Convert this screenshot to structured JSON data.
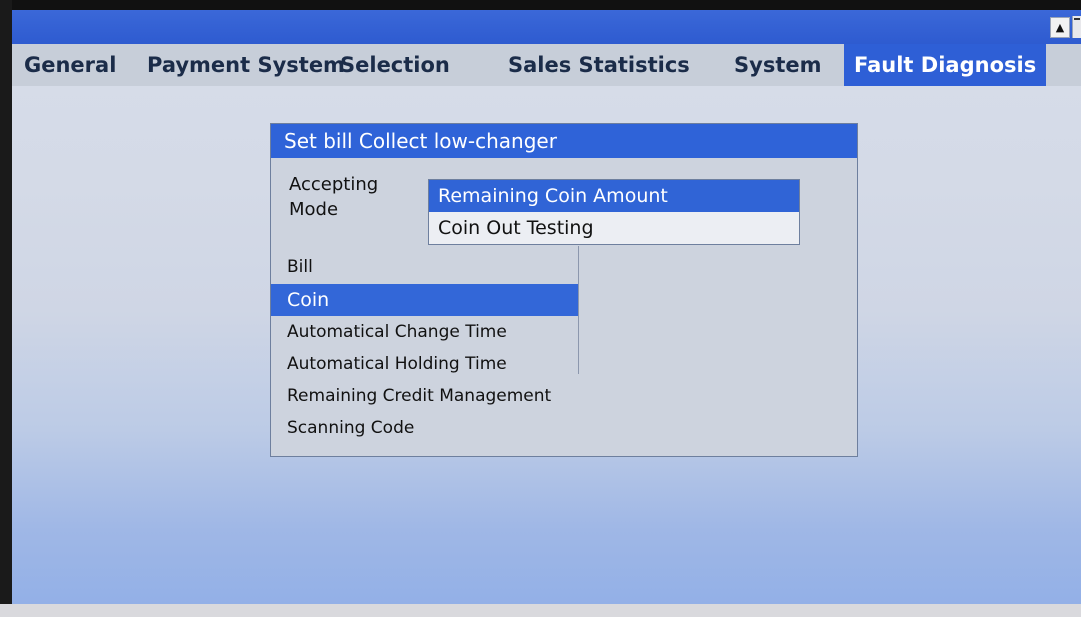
{
  "tabs": [
    {
      "label": "General"
    },
    {
      "label": "Payment System"
    },
    {
      "label": "Selection"
    },
    {
      "label": "Sales Statistics"
    },
    {
      "label": "System"
    },
    {
      "label": "Fault Diagnosis",
      "active": true
    }
  ],
  "scroll": {
    "up_icon": "▲"
  },
  "dialog": {
    "title": "Set bill Collect low-changer",
    "mode_label": "Accepting\nMode",
    "dropdown": [
      {
        "label": "Remaining Coin Amount",
        "selected": true
      },
      {
        "label": "Coin Out Testing",
        "selected": false
      }
    ],
    "menu": [
      {
        "label": "Bill",
        "selected": false
      },
      {
        "label": "Coin",
        "selected": true
      },
      {
        "label": "Automatical Change Time",
        "selected": false
      },
      {
        "label": "Automatical Holding Time",
        "selected": false
      },
      {
        "label": "Remaining Credit Management",
        "selected": false
      },
      {
        "label": "Scanning Code",
        "selected": false
      }
    ]
  },
  "colors": {
    "accent": "#2f63d8",
    "tab_bar": "#c7ced9",
    "dialog_bg": "#cdd3de"
  }
}
